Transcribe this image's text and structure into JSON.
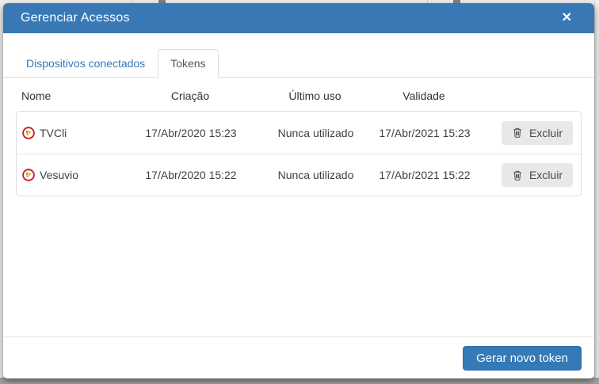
{
  "modal": {
    "title": "Gerenciar Acessos",
    "close_icon": "✕",
    "tabs": [
      {
        "label": "Dispositivos conectados",
        "active": false
      },
      {
        "label": "Tokens",
        "active": true
      }
    ],
    "table": {
      "columns": [
        "Nome",
        "Criação",
        "Último uso",
        "Validade"
      ],
      "rows": [
        {
          "name": "TVCli",
          "created": "17/Abr/2020 15:23",
          "last_use": "Nunca utilizado",
          "validity": "17/Abr/2021 15:23",
          "delete_label": "Excluir"
        },
        {
          "name": "Vesuvio",
          "created": "17/Abr/2020 15:22",
          "last_use": "Nunca utilizado",
          "validity": "17/Abr/2021 15:22",
          "delete_label": "Excluir"
        }
      ]
    },
    "footer": {
      "generate_button": "Gerar novo token"
    }
  },
  "icons": {
    "close": "bold white X glyph",
    "delete": "outline trash can",
    "token_logo": "red ring circle with green/orange pinwheel triangle"
  },
  "colors": {
    "header_bg": "#3879b5",
    "primary_button": "#337ab7",
    "primary_button_border": "#2e6da4",
    "link": "#337ab7",
    "border": "#dddddd",
    "delete_button_bg": "#e8e8e8",
    "logo_ring": "#cb2026",
    "logo_green": "#76b043",
    "logo_orange": "#f6a01a",
    "backdrop_bottom": "#a2a2a2"
  }
}
